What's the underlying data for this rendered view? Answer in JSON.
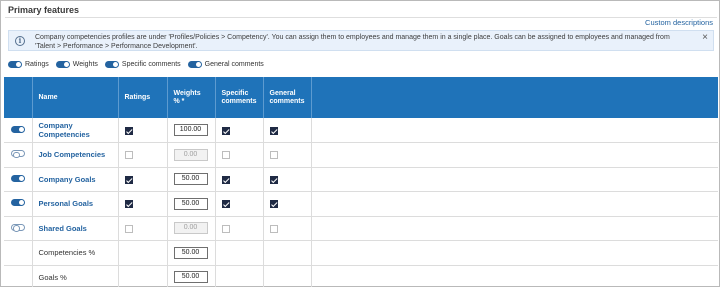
{
  "panel": {
    "title": "Primary features"
  },
  "custom_descriptions_label": "Custom descriptions",
  "info": {
    "icon": "info-icon",
    "text": "Company competencies profiles are under 'Profiles/Policies > Competency'. You can assign them to employees and manage them in a single place. Goals can be assigned to employees and managed from 'Talent > Performance > Performance Development'.",
    "close": "×"
  },
  "toggles": [
    {
      "label": "Ratings",
      "on": true
    },
    {
      "label": "Weights",
      "on": true
    },
    {
      "label": "Specific comments",
      "on": true
    },
    {
      "label": "General comments",
      "on": true
    }
  ],
  "table": {
    "headers": [
      "",
      "Name",
      "Ratings",
      "Weights % *",
      "Specific comments",
      "General comments",
      ""
    ],
    "rows": [
      {
        "switch": true,
        "name": "Company Competencies",
        "link": true,
        "ratings": true,
        "weight": "100.00",
        "weight_enabled": true,
        "specific": true,
        "general": true
      },
      {
        "switch": false,
        "name": "Job Competencies",
        "link": true,
        "ratings": false,
        "weight": "0.00",
        "weight_enabled": false,
        "specific": false,
        "general": false
      },
      {
        "switch": true,
        "name": "Company Goals",
        "link": true,
        "ratings": true,
        "weight": "50.00",
        "weight_enabled": true,
        "specific": true,
        "general": true
      },
      {
        "switch": true,
        "name": "Personal Goals",
        "link": true,
        "ratings": true,
        "weight": "50.00",
        "weight_enabled": true,
        "specific": true,
        "general": true
      },
      {
        "switch": false,
        "name": "Shared Goals",
        "link": true,
        "ratings": false,
        "weight": "0.00",
        "weight_enabled": false,
        "specific": false,
        "general": false
      },
      {
        "summary": true,
        "name": "Competencies %",
        "weight": "50.00"
      },
      {
        "summary": true,
        "name": "Goals %",
        "weight": "50.00"
      }
    ]
  },
  "colors": {
    "header_blue": "#1f73b9",
    "link_blue": "#2463a0",
    "info_bg": "#e9f1fb",
    "check_dark": "#1f2a44"
  }
}
